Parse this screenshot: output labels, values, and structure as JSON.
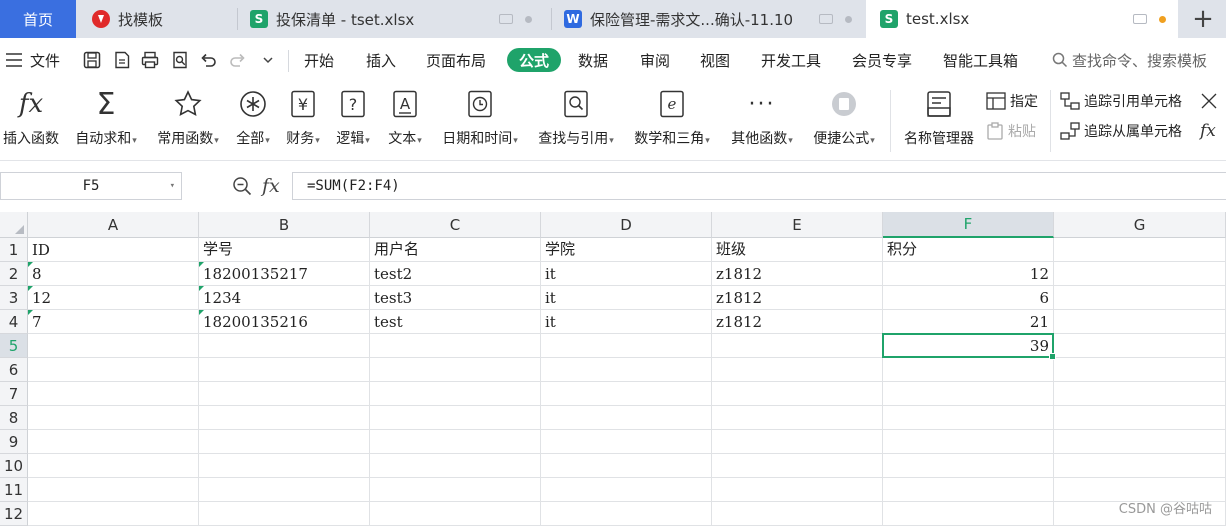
{
  "tabs": {
    "home": "首页",
    "template": "找模板",
    "file1": "投保清单 - tset.xlsx",
    "file2": "保险管理-需求文...确认-11.10",
    "file3": "test.xlsx",
    "new_tab": "+"
  },
  "menu": {
    "file": "文件",
    "items": [
      "开始",
      "插入",
      "页面布局",
      "公式",
      "数据",
      "审阅",
      "视图",
      "开发工具",
      "会员专享",
      "智能工具箱"
    ],
    "active": "公式",
    "search_placeholder": "查找命令、搜索模板"
  },
  "ribbon": {
    "insert_function": "插入函数",
    "autosum": "自动求和",
    "common": "常用函数",
    "all": "全部",
    "finance": "财务",
    "logic": "逻辑",
    "text": "文本",
    "datetime": "日期和时间",
    "lookup": "查找与引用",
    "math": "数学和三角",
    "other": "其他函数",
    "convenient": "便捷公式",
    "name_manager": "名称管理器",
    "specify": "指定",
    "paste": "粘贴",
    "trace_precedents": "追踪引用单元格",
    "trace_dependents": "追踪从属单元格"
  },
  "formula_bar": {
    "name_box": "F5",
    "formula": "=SUM(F2:F4)"
  },
  "sheet": {
    "columns": [
      "A",
      "B",
      "C",
      "D",
      "E",
      "F",
      "G"
    ],
    "rows": [
      "1",
      "2",
      "3",
      "4",
      "5",
      "6",
      "7",
      "8",
      "9",
      "10",
      "11",
      "12"
    ],
    "selected_cell": "F5",
    "cells": [
      [
        "ID",
        "学号",
        "用户名",
        "学院",
        "班级",
        "积分"
      ],
      [
        "8",
        "18200135217",
        "test2",
        "it",
        "z1812",
        "12"
      ],
      [
        "12",
        "1234",
        "test3",
        "it",
        "z1812",
        "6"
      ],
      [
        "7",
        "18200135216",
        "test",
        "it",
        "z1812",
        "21"
      ],
      [
        "",
        "",
        "",
        "",
        "",
        "39"
      ]
    ]
  },
  "watermark": "CSDN @谷咕咕"
}
